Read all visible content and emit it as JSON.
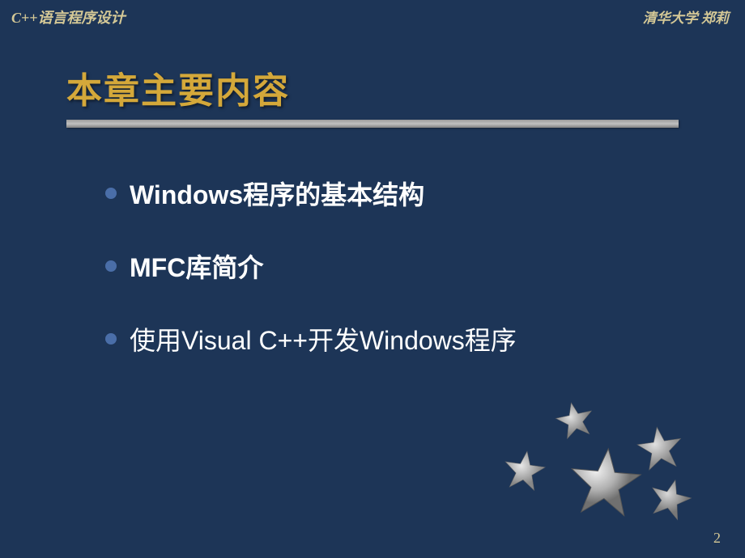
{
  "header": {
    "left": "C++语言程序设计",
    "right": "清华大学 郑莉"
  },
  "title": "本章主要内容",
  "bullets": [
    "Windows程序的基本结构",
    "MFC库简介",
    "使用Visual C++开发Windows程序"
  ],
  "page_number": "2"
}
